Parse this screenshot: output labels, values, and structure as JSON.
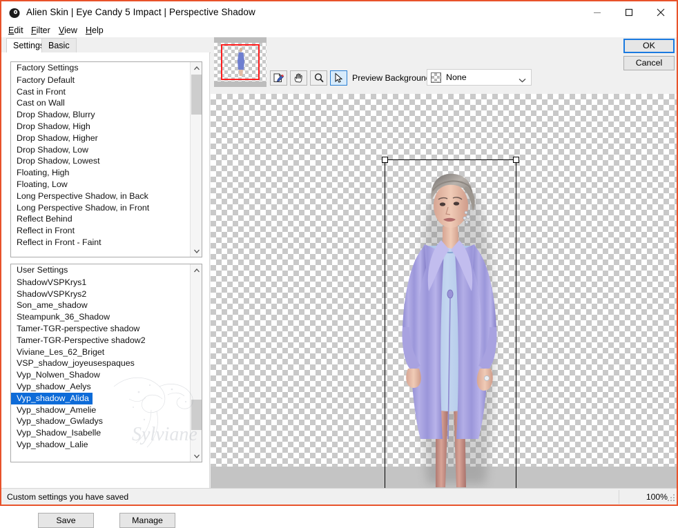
{
  "window": {
    "title": "Alien Skin | Eye Candy 5 Impact | Perspective Shadow",
    "icon": "app-icon",
    "minimize_label": "–",
    "maximize_label": "☐",
    "close_label": "✕"
  },
  "menu": [
    {
      "label": "Edit"
    },
    {
      "label": "Filter"
    },
    {
      "label": "View"
    },
    {
      "label": "Help"
    }
  ],
  "tabs": [
    {
      "label": "Settings",
      "active": true
    },
    {
      "label": "Basic",
      "active": false
    }
  ],
  "factory_list": {
    "header": "Factory Settings",
    "items": [
      "Factory Default",
      "Cast in Front",
      "Cast on Wall",
      "Drop Shadow, Blurry",
      "Drop Shadow, High",
      "Drop Shadow, Higher",
      "Drop Shadow, Low",
      "Drop Shadow, Lowest",
      "Floating, High",
      "Floating, Low",
      "Long Perspective Shadow, in Back",
      "Long Perspective Shadow, in Front",
      "Reflect Behind",
      "Reflect in Front",
      "Reflect in Front - Faint"
    ],
    "selected": null
  },
  "user_list": {
    "header": "User Settings",
    "items": [
      "ShadowVSPKrys1",
      "ShadowVSPKrys2",
      "Son_ame_shadow",
      "Steampunk_36_Shadow",
      "Tamer-TGR-perspective shadow",
      "Tamer-TGR-Perspective shadow2",
      "Viviane_Les_62_Briget",
      "VSP_shadow_joyeusespaques",
      "Vyp_Nolwen_Shadow",
      "Vyp_shadow_Aelys",
      "Vyp_shadow_Alida",
      "Vyp_shadow_Amelie",
      "Vyp_shadow_Gwladys",
      "Vyp_Shadow_Isabelle",
      "Vyp_shadow_Lalie"
    ],
    "selected": "Vyp_shadow_Alida"
  },
  "buttons": {
    "save": "Save",
    "manage": "Manage",
    "ok": "OK",
    "cancel": "Cancel"
  },
  "toolbar": {
    "tools": [
      {
        "name": "eyedropper-icon",
        "active": false
      },
      {
        "name": "hand-icon",
        "active": false
      },
      {
        "name": "zoom-icon",
        "active": false
      },
      {
        "name": "pointer-icon",
        "active": true
      }
    ],
    "preview_background_label": "Preview Background:",
    "preview_background_value": "None"
  },
  "statusbar": {
    "message": "Custom settings you have saved",
    "zoom": "100%"
  },
  "colors": {
    "window_border": "#E8522A",
    "selection_highlight": "#0d6bd8",
    "navigator_rect": "#ff1d1d",
    "focus_border": "#1a7ae0",
    "panel_bg": "#f0f0f0"
  },
  "watermark": {
    "text": "Sylviane"
  }
}
